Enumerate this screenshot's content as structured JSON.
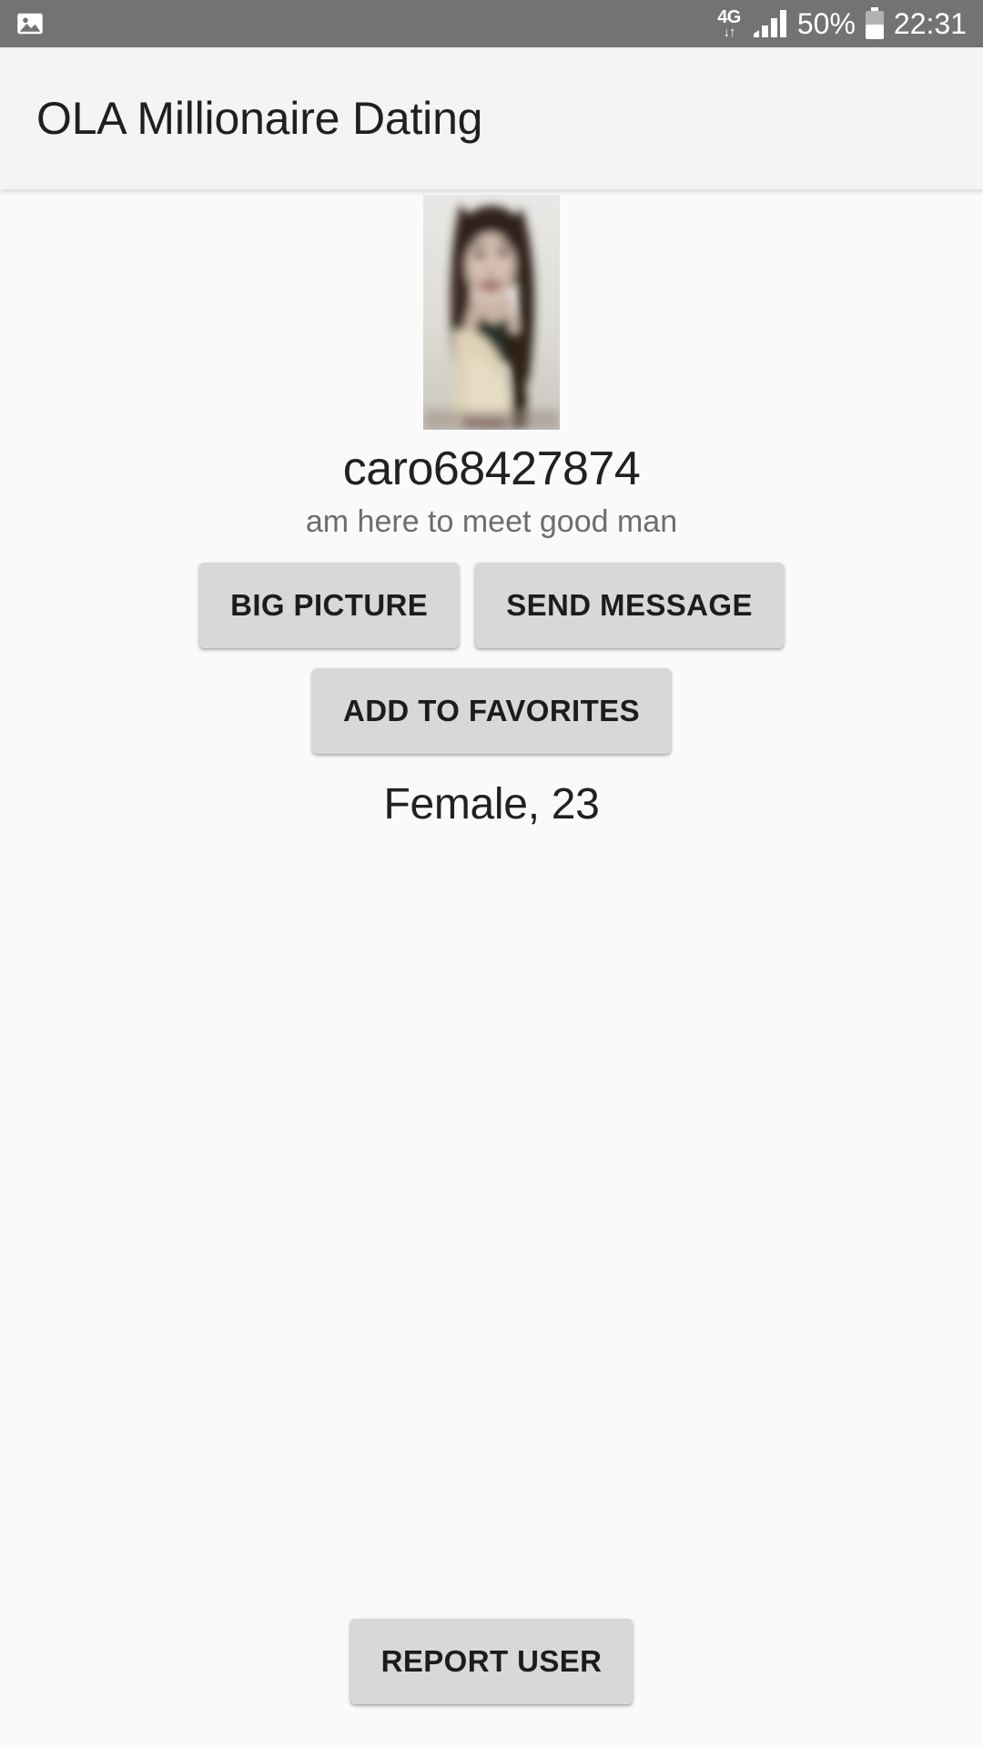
{
  "status_bar": {
    "notification_icon": "photo-icon",
    "network_type": "4G",
    "network_arrows": "↓↑",
    "signal_icon": "signal-bars-icon",
    "battery_percent": "50%",
    "battery_icon": "battery-half-icon",
    "time": "22:31",
    "background_color": "#737373",
    "foreground_color": "#ffffff"
  },
  "app_bar": {
    "title": "OLA Millionaire Dating",
    "background_color": "#f4f4f4",
    "text_color": "#1f1f1f"
  },
  "profile": {
    "avatar_alt": "profile-photo",
    "username": "caro68427874",
    "tagline": "am here to meet good man",
    "gender_age": "Female, 23"
  },
  "actions": {
    "big_picture": "BIG PICTURE",
    "send_message": "SEND MESSAGE",
    "add_to_favorites": "ADD TO FAVORITES",
    "report_user": "REPORT USER",
    "button_color": "#d8d8d8",
    "button_text_color": "#1c1c1c"
  },
  "page": {
    "background_color": "#fafafa"
  }
}
